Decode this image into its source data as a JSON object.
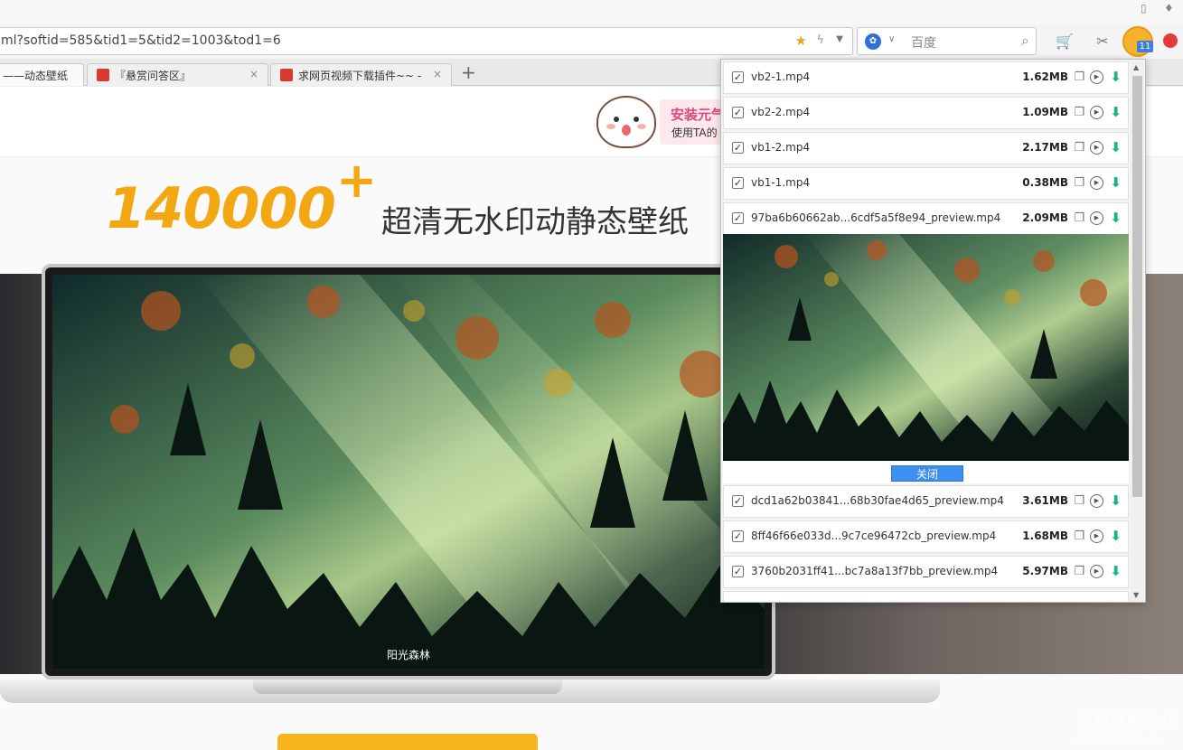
{
  "window": {
    "ctrl_left": "▯",
    "ctrl_right": "♦"
  },
  "address_bar": {
    "url": "ml?softid=585&tid1=5&tid2=1003&tod1=6",
    "star_icon": "star-icon",
    "bolt_icon": "bolt-icon"
  },
  "search_bar": {
    "engine_icon": "baidu-paw-icon",
    "placeholder": "百度"
  },
  "toolbar_icons": {
    "cart": "🛒",
    "scissors": "✂",
    "extension_badge": "11"
  },
  "tabs": [
    {
      "title": "——动态壁纸",
      "close": "×"
    },
    {
      "title": "『悬赏问答区』",
      "close": "×"
    },
    {
      "title": "求网页视频下载插件~~ -",
      "close": "×"
    }
  ],
  "new_tab_label": "+",
  "page": {
    "promo_title": "安装元气",
    "promo_subtitle": "使用TA的",
    "hero_number": "140000",
    "hero_plus": "+",
    "hero_text": "超清无水印动静态壁纸",
    "wallpaper_caption": "阳光森林",
    "watermark_title": "吾爱破解论坛",
    "watermark_url": "www.52pojie.cn"
  },
  "download_panel": {
    "items_top": [
      {
        "name": "vb2-1.mp4",
        "size": "1.62MB",
        "checked": true
      },
      {
        "name": "vb2-2.mp4",
        "size": "1.09MB",
        "checked": true
      },
      {
        "name": "vb1-2.mp4",
        "size": "2.17MB",
        "checked": true
      },
      {
        "name": "vb1-1.mp4",
        "size": "0.38MB",
        "checked": true
      },
      {
        "name": "97ba6b60662ab...6cdf5a5f8e94_preview.mp4",
        "size": "2.09MB",
        "checked": true
      }
    ],
    "close_label": "关闭",
    "items_bottom": [
      {
        "name": "dcd1a62b03841...68b30fae4d65_preview.mp4",
        "size": "3.61MB",
        "checked": true
      },
      {
        "name": "8ff46f66e033d...9c7ce96472cb_preview.mp4",
        "size": "1.68MB",
        "checked": true
      },
      {
        "name": "3760b2031ff41...bc7a8a13f7bb_preview.mp4",
        "size": "5.97MB",
        "checked": true
      }
    ],
    "check_glyph": "✓",
    "copy_glyph": "❐",
    "play_glyph": "▶",
    "download_glyph": "⬇"
  },
  "colors": {
    "accent_orange": "#f3a712",
    "download_green": "#1fb28a",
    "close_button_blue": "#3d8ff0"
  }
}
